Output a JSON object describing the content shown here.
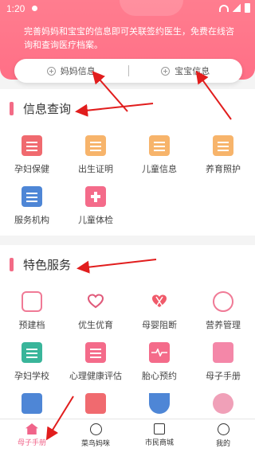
{
  "status_bar": {
    "time": "1:20"
  },
  "banner": {
    "text": "完善妈妈和宝宝的信息即可关联签约医生，免费在线咨询和查询医疗档案。"
  },
  "tabs": [
    {
      "label": "妈妈信息"
    },
    {
      "label": "宝宝信息"
    }
  ],
  "section_info": {
    "title": "信息查询",
    "items": [
      {
        "label": "孕妇保健",
        "icon": "clipboard-icon"
      },
      {
        "label": "出生证明",
        "icon": "certificate-icon"
      },
      {
        "label": "儿童信息",
        "icon": "child-info-icon"
      },
      {
        "label": "养育照护",
        "icon": "parenting-icon"
      },
      {
        "label": "服务机构",
        "icon": "institution-icon"
      },
      {
        "label": "儿童体检",
        "icon": "medical-check-icon"
      }
    ]
  },
  "section_special": {
    "title": "特色服务",
    "items": [
      {
        "label": "预建档",
        "icon": "pregnant-card-icon"
      },
      {
        "label": "优生优育",
        "icon": "heart-icon"
      },
      {
        "label": "母婴阻断",
        "icon": "ribbon-icon"
      },
      {
        "label": "营养管理",
        "icon": "nutrition-icon"
      },
      {
        "label": "孕妇学校",
        "icon": "school-icon"
      },
      {
        "label": "心理健康评估",
        "icon": "document-icon"
      },
      {
        "label": "胎心预约",
        "icon": "heartbeat-icon"
      },
      {
        "label": "母子手册",
        "icon": "handbook-icon"
      }
    ]
  },
  "bottom_nav": [
    {
      "label": "母子手册",
      "active": true
    },
    {
      "label": "菜鸟妈咪",
      "active": false
    },
    {
      "label": "市民商城",
      "active": false
    },
    {
      "label": "我的",
      "active": false
    }
  ],
  "colors": {
    "accent": "#f0648a",
    "banner": "#ff7d8f",
    "annotation": "#e11d1d"
  }
}
